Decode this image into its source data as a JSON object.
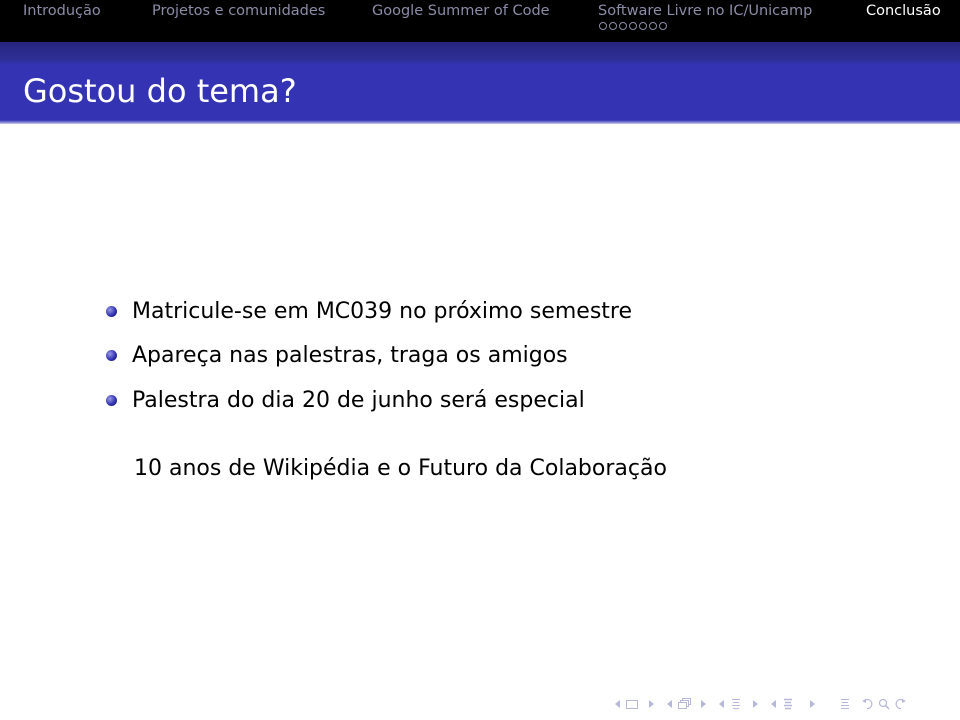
{
  "headline": {
    "sections": [
      {
        "label": "Introdução",
        "active": false
      },
      {
        "label": "Projetos e comunidades",
        "active": false
      },
      {
        "label": "Google Summer of Code",
        "active": false
      },
      {
        "label": "Software Livre no IC/Unicamp",
        "active": false,
        "mini_frames": 7
      },
      {
        "label": "Conclusão",
        "active": true
      }
    ]
  },
  "frame": {
    "title": "Gostou do tema?",
    "bullets": [
      "Matricule-se em MC039 no próximo semestre",
      "Apareça nas palestras, traga os amigos",
      "Palestra do dia 20 de junho será especial"
    ],
    "note": "10 anos de Wikipédia e o Futuro da Colaboração"
  },
  "navigation": {
    "icons": [
      "arrow-left",
      "frame",
      "arrow-right",
      "arrow-left",
      "subsection",
      "arrow-right",
      "arrow-left",
      "section",
      "arrow-right",
      "arrow-left",
      "presentation",
      "arrow-right",
      "align",
      "back",
      "search",
      "forward"
    ]
  },
  "colors": {
    "headline_bg": "#000000",
    "title_bg": "#3333b3",
    "inactive_nav": "#8c8ca8",
    "nav_symbols": "#b7b7d9"
  }
}
